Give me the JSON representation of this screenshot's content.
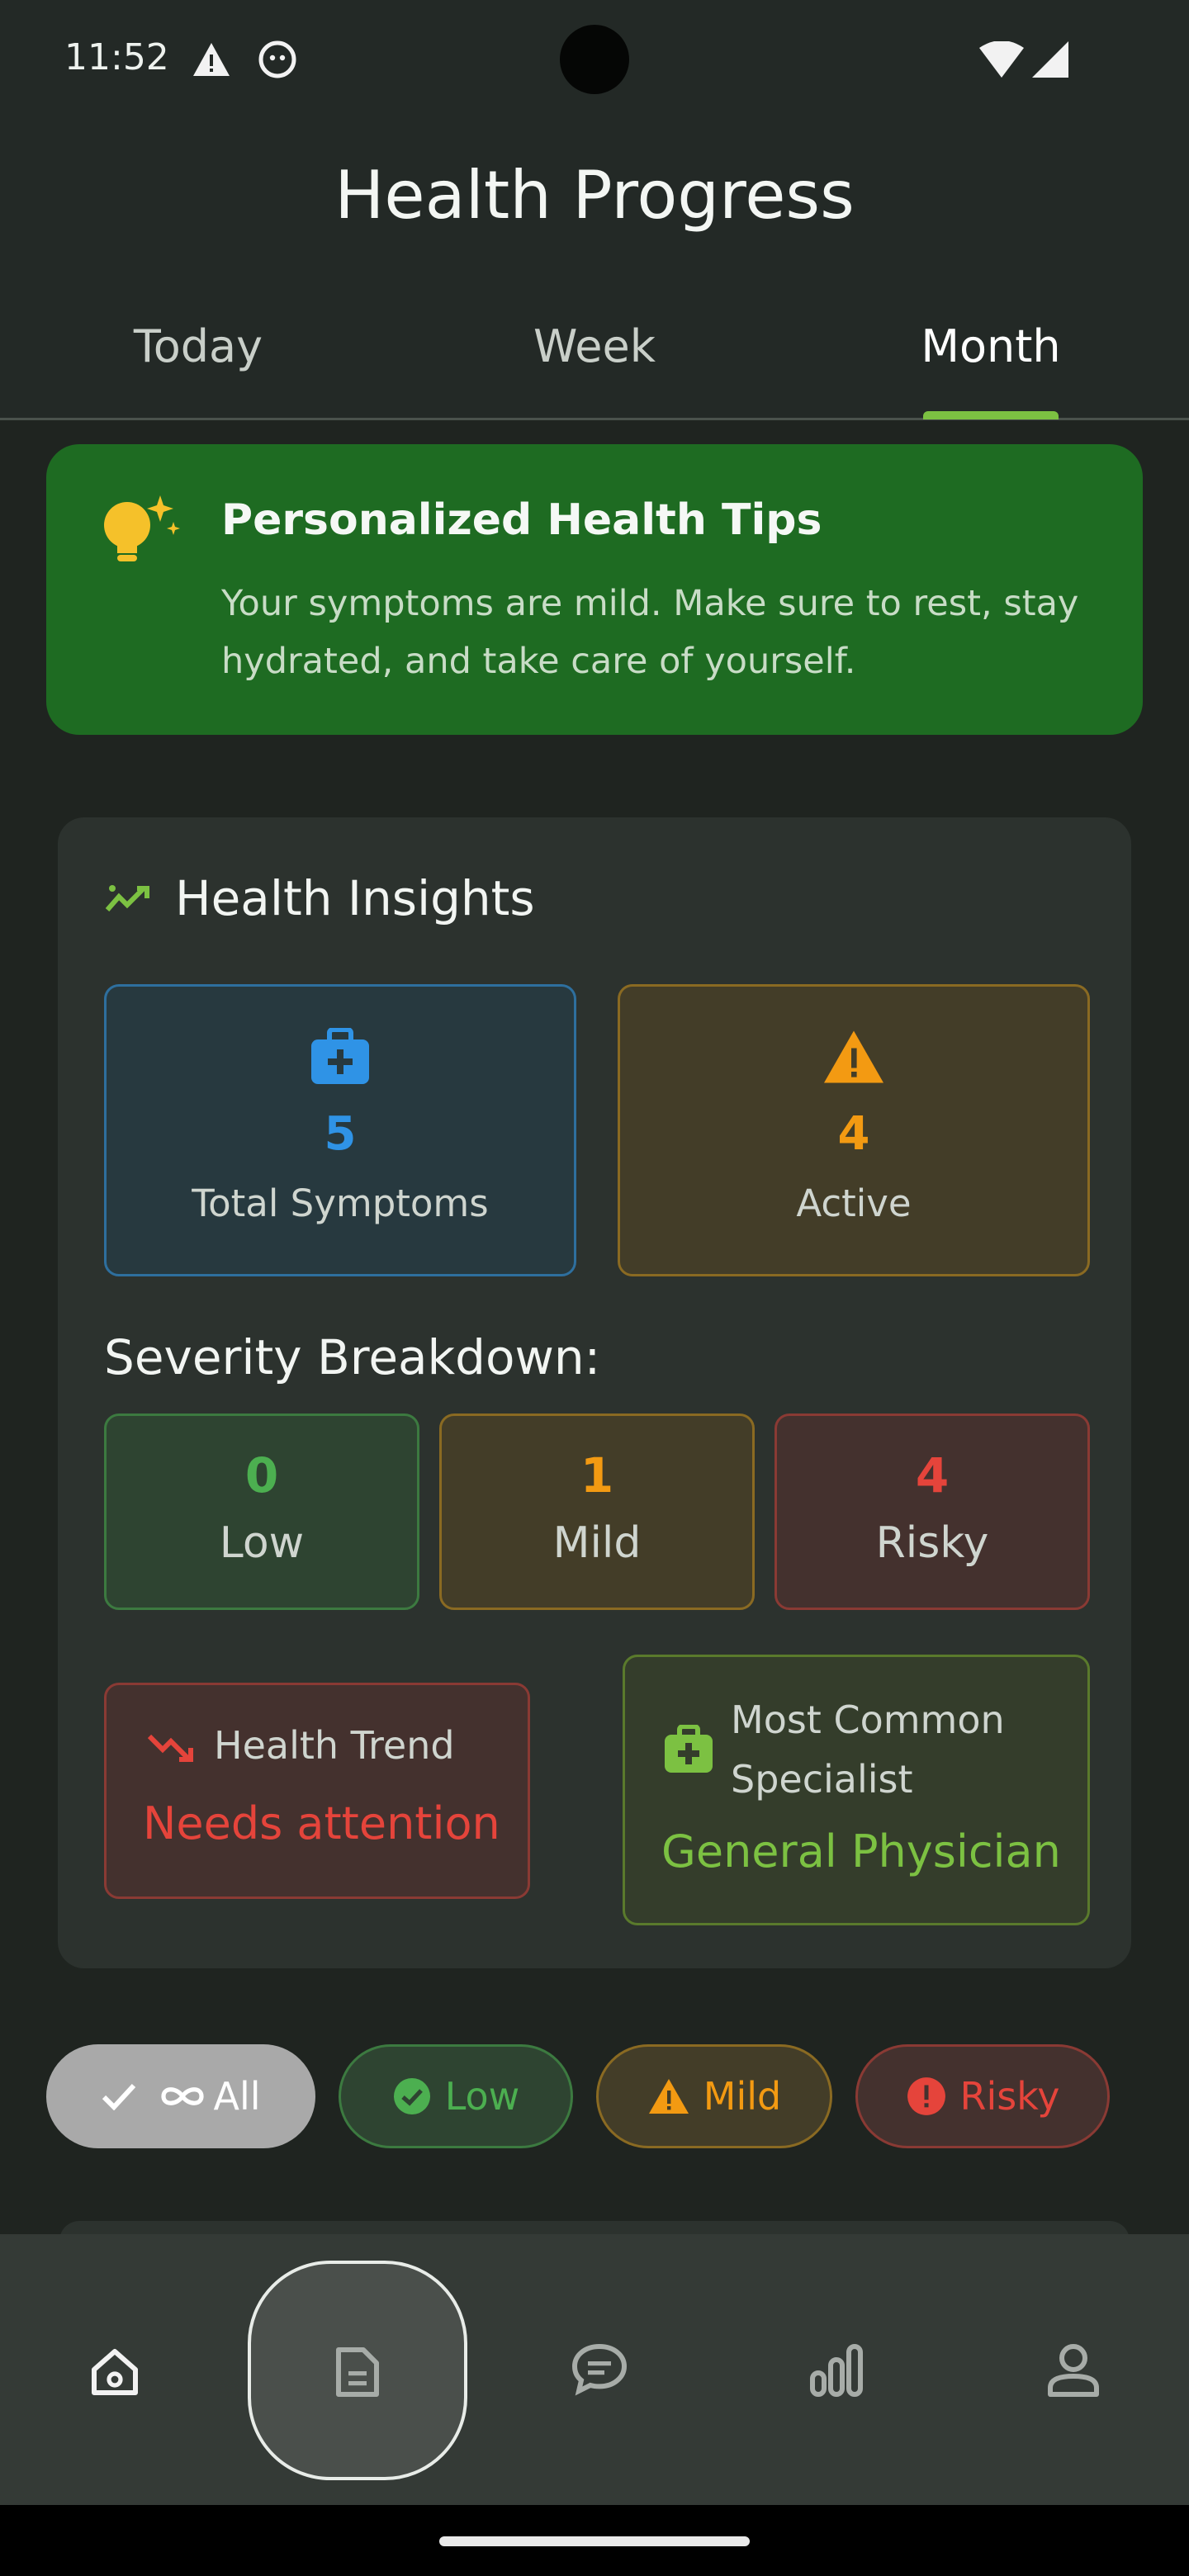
{
  "status_bar": {
    "time": "11:52"
  },
  "header": {
    "title": "Health Progress"
  },
  "tabs": [
    {
      "label": "Today"
    },
    {
      "label": "Week"
    },
    {
      "label": "Month",
      "active": true
    }
  ],
  "tips": {
    "title": "Personalized Health Tips",
    "body": "Your symptoms are mild. Make sure to rest, stay hydrated, and take care of yourself."
  },
  "insights": {
    "title": "Health Insights",
    "total": {
      "value": "5",
      "label": "Total Symptoms"
    },
    "active": {
      "value": "4",
      "label": "Active"
    },
    "severity_title": "Severity Breakdown:",
    "severity": [
      {
        "value": "0",
        "label": "Low"
      },
      {
        "value": "1",
        "label": "Mild"
      },
      {
        "value": "4",
        "label": "Risky"
      }
    ],
    "trend": {
      "label": "Health Trend",
      "value": "Needs attention"
    },
    "specialist": {
      "label": "Most Common Specialist",
      "value": "General Physician"
    }
  },
  "filters": [
    {
      "label": "All",
      "selected": true
    },
    {
      "label": "Low"
    },
    {
      "label": "Mild"
    },
    {
      "label": "Risky"
    }
  ],
  "bottom_nav": [
    "home-icon",
    "document-icon",
    "chat-icon",
    "chart-icon",
    "profile-icon"
  ],
  "colors": {
    "accent_green": "#7cc142",
    "tips_bg": "#1e6b22",
    "blue": "#2f93e6",
    "orange": "#f39a12",
    "red": "#e5443b",
    "green": "#4caf50"
  }
}
